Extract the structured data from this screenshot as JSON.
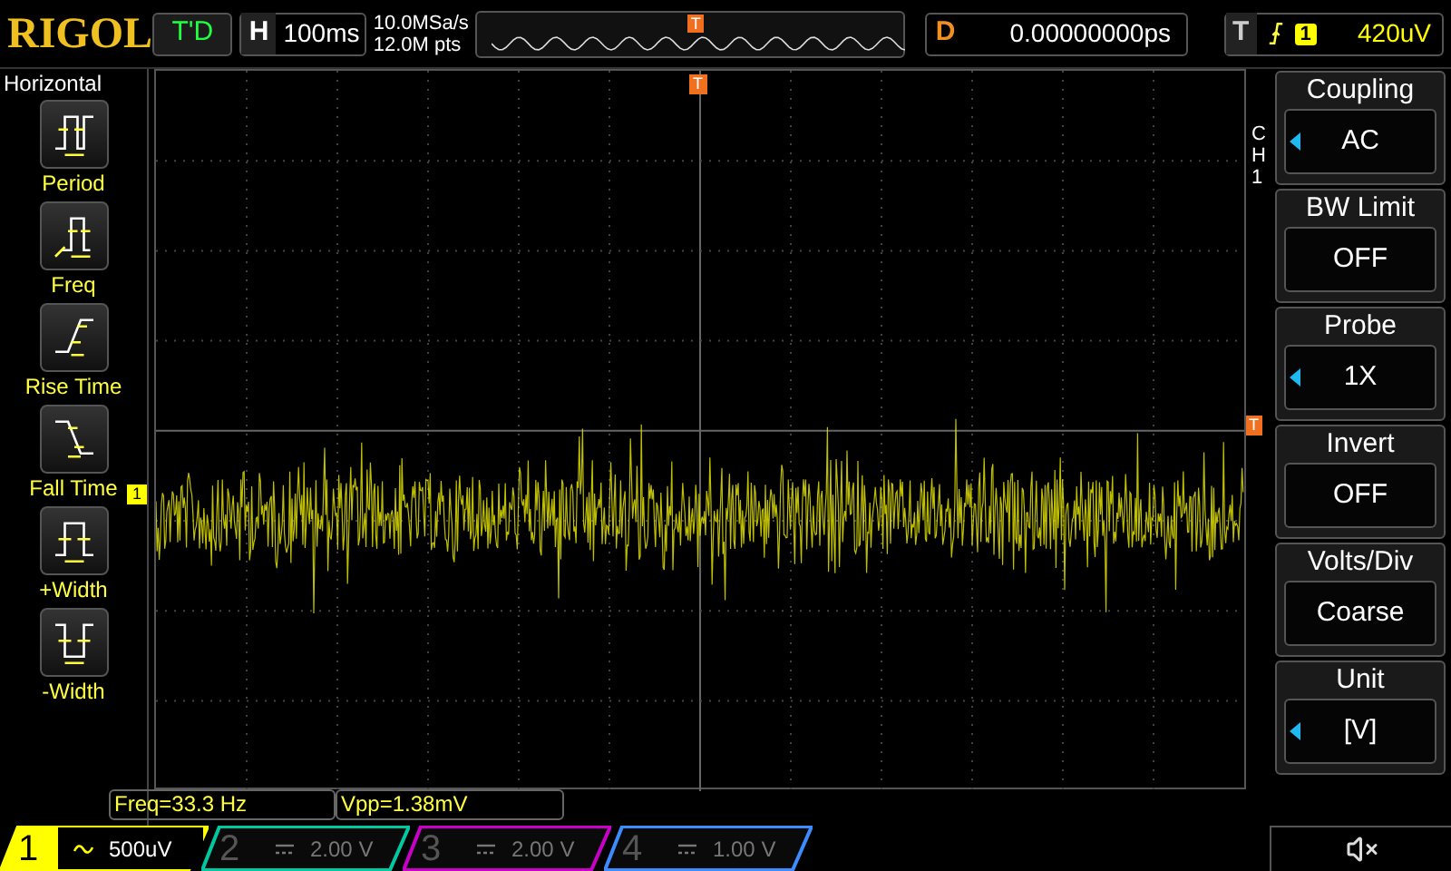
{
  "top_bar": {
    "logo": "RIGOL",
    "trigger_status": "T'D",
    "horizontal": {
      "label": "H",
      "value": "100ms"
    },
    "sample_rate": "10.0MSa/s",
    "memory_depth": "12.0M pts",
    "trigger_marker": "T",
    "delay": {
      "label": "D",
      "value": "0.00000000ps"
    },
    "trigger": {
      "label": "T",
      "source": "1",
      "level": "420uV"
    }
  },
  "left_menu": {
    "title": "Horizontal",
    "items": [
      {
        "kind": "period",
        "label": "Period"
      },
      {
        "kind": "freq",
        "label": "Freq"
      },
      {
        "kind": "rise",
        "label": "Rise Time"
      },
      {
        "kind": "fall",
        "label": "Fall Time"
      },
      {
        "kind": "pwidth",
        "label": "+Width"
      },
      {
        "kind": "nwidth",
        "label": "-Width"
      }
    ]
  },
  "display": {
    "channel_marker": "1",
    "trigger_level_marker": "T",
    "trigger_position_marker": "T"
  },
  "right_menu": {
    "channel": "CH1",
    "items": [
      {
        "title": "Coupling",
        "value": "AC",
        "adjustable": true
      },
      {
        "title": "BW Limit",
        "value": "OFF",
        "adjustable": false
      },
      {
        "title": "Probe",
        "value": "1X",
        "adjustable": true
      },
      {
        "title": "Invert",
        "value": "OFF",
        "adjustable": false
      },
      {
        "title": "Volts/Div",
        "value": "Coarse",
        "adjustable": false
      },
      {
        "title": "Unit",
        "value": "[V]",
        "adjustable": true
      }
    ]
  },
  "measurements": [
    "Freq=33.3 Hz",
    "Vpp=1.38mV"
  ],
  "channels": [
    {
      "number": "1",
      "kind": "ac",
      "scale": "500uV",
      "active": true,
      "color": "#ffff00"
    },
    {
      "number": "2",
      "kind": "dc",
      "scale": "2.00 V",
      "active": false,
      "color": "#00c8a0"
    },
    {
      "number": "3",
      "kind": "dc",
      "scale": "2.00 V",
      "active": false,
      "color": "#c800c8"
    },
    {
      "number": "4",
      "kind": "dc",
      "scale": "1.00 V",
      "active": false,
      "color": "#3c8cff"
    }
  ]
}
